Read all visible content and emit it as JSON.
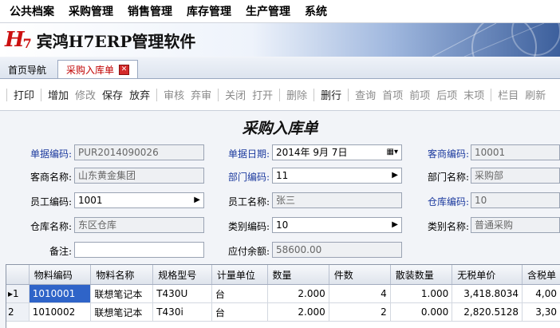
{
  "menu": [
    "公共档案",
    "采购管理",
    "销售管理",
    "库存管理",
    "生产管理",
    "系统"
  ],
  "banner": {
    "logo_h": "H",
    "logo_7": "7",
    "title": "宾鸿H7ERP管理软件"
  },
  "tabs": [
    {
      "label": "首页导航"
    },
    {
      "label": "采购入库单",
      "close": "✕"
    }
  ],
  "toolbar": [
    {
      "label": "打印",
      "dim": false
    },
    {
      "label": "增加",
      "dim": false
    },
    {
      "label": "修改",
      "dim": true
    },
    {
      "label": "保存",
      "dim": false
    },
    {
      "label": "放弃",
      "dim": false
    },
    {
      "label": "审核",
      "dim": true
    },
    {
      "label": "弃审",
      "dim": true
    },
    {
      "label": "关闭",
      "dim": true
    },
    {
      "label": "打开",
      "dim": true
    },
    {
      "label": "删除",
      "dim": true
    },
    {
      "label": "删行",
      "dim": false
    },
    {
      "label": "查询",
      "dim": true
    },
    {
      "label": "首项",
      "dim": true
    },
    {
      "label": "前项",
      "dim": true
    },
    {
      "label": "后项",
      "dim": true
    },
    {
      "label": "末项",
      "dim": true
    },
    {
      "label": "栏目",
      "dim": true
    },
    {
      "label": "刷新",
      "dim": true
    }
  ],
  "form": {
    "title": "采购入库单",
    "doc_no_label": "单据编码:",
    "doc_no": "PUR2014090026",
    "doc_date_label": "单据日期:",
    "doc_date": "2014年  9月  7日",
    "vendor_code_label": "客商编码:",
    "vendor_code": "10001",
    "vendor_name_label": "客商名称:",
    "vendor_name": "山东黄金集团",
    "dept_code_label": "部门编码:",
    "dept_code": "11",
    "dept_name_label": "部门名称:",
    "dept_name": "采购部",
    "emp_code_label": "员工编码:",
    "emp_code": "1001",
    "emp_name_label": "员工名称:",
    "emp_name": "张三",
    "wh_code_label": "仓库编码:",
    "wh_code": "10",
    "wh_name_label": "仓库名称:",
    "wh_name": "东区仓库",
    "cat_code_label": "类别编码:",
    "cat_code": "10",
    "cat_name_label": "类别名称:",
    "cat_name": "普通采购",
    "note_label": "备注:",
    "note": "",
    "payable_label": "应付余额:",
    "payable": "58600.00"
  },
  "grid": {
    "columns": [
      "物料编码",
      "物料名称",
      "规格型号",
      "计量单位",
      "数量",
      "件数",
      "散装数量",
      "无税单价",
      "含税单"
    ],
    "rows": [
      {
        "marker": "▸1",
        "code": "1010001",
        "name": "联想笔记本",
        "spec": "T430U",
        "unit": "台",
        "qty": "2.000",
        "pieces": "4",
        "loose": "1.000",
        "price": "3,418.8034",
        "tax_price": "4,00"
      },
      {
        "marker": "2",
        "code": "1010002",
        "name": "联想笔记本",
        "spec": "T430i",
        "unit": "台",
        "qty": "2.000",
        "pieces": "2",
        "loose": "0.000",
        "price": "2,820.5128",
        "tax_price": "3,30"
      }
    ]
  }
}
